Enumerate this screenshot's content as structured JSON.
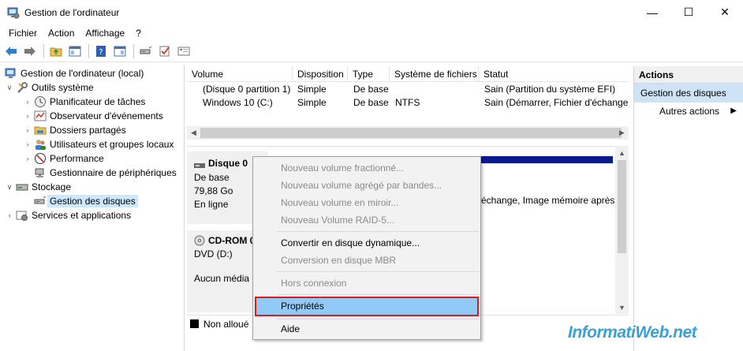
{
  "window": {
    "title": "Gestion de l'ordinateur"
  },
  "menubar": [
    "Fichier",
    "Action",
    "Affichage",
    "?"
  ],
  "tree": {
    "root": "Gestion de l'ordinateur (local)",
    "tools": "Outils système",
    "scheduler": "Planificateur de tâches",
    "events": "Observateur d'événements",
    "shared": "Dossiers partagés",
    "users": "Utilisateurs et groupes locaux",
    "perf": "Performance",
    "devices": "Gestionnaire de périphériques",
    "storage": "Stockage",
    "disks": "Gestion des disques",
    "services": "Services et applications"
  },
  "volumes": {
    "headers": {
      "volume": "Volume",
      "layout": "Disposition",
      "type": "Type",
      "fs": "Système de fichiers",
      "status": "Statut"
    },
    "rows": [
      {
        "volume": "(Disque 0 partition 1)",
        "layout": "Simple",
        "type": "De base",
        "fs": "",
        "status": "Sain (Partition du système EFI)"
      },
      {
        "volume": "Windows 10 (C:)",
        "layout": "Simple",
        "type": "De base",
        "fs": "NTFS",
        "status": "Sain (Démarrer, Fichier d'échange,"
      }
    ]
  },
  "disks": {
    "disk0": {
      "name": "Disque 0",
      "type": "De base",
      "size": "79,88 Go",
      "state": "En ligne",
      "partition_status": "échange, Image mémoire après"
    },
    "cdrom": {
      "name": "CD-ROM 0",
      "drive": "DVD (D:)",
      "state": "Aucun média"
    },
    "legend": "Non alloué"
  },
  "actions": {
    "header": "Actions",
    "section": "Gestion des disques",
    "more": "Autres actions"
  },
  "context_menu": {
    "striped": "Nouveau volume fractionné...",
    "spanned": "Nouveau volume agrégé par bandes...",
    "mirror": "Nouveau volume en miroir...",
    "raid5": "Nouveau Volume RAID-5...",
    "dynamic": "Convertir en disque dynamique...",
    "mbr": "Conversion en disque MBR",
    "offline": "Hors connexion",
    "properties": "Propriétés",
    "help": "Aide"
  },
  "watermark": "InformatiWeb.net",
  "colors": {
    "selection": "#cce8ff",
    "highlight": "#91c9f7",
    "highlight_border": "#e01a1a",
    "disk_bar": "#0b1a8c",
    "watermark": "#3aa0d8"
  }
}
